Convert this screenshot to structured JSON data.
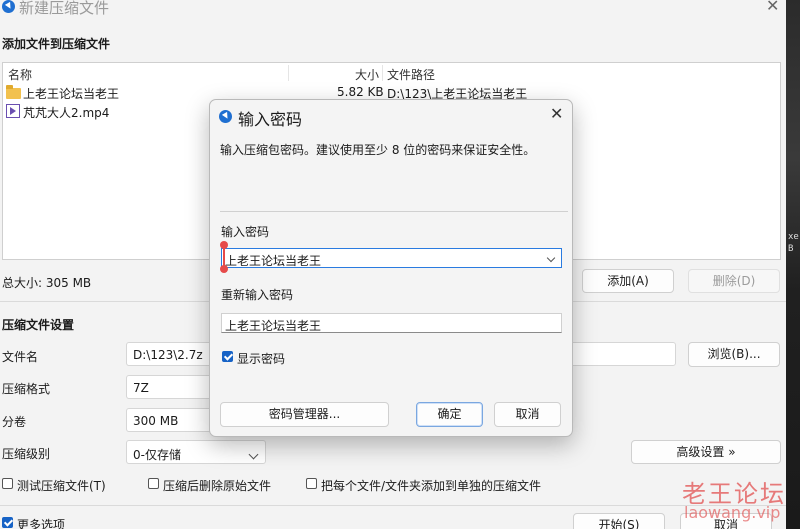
{
  "window": {
    "title": "新建压缩文件",
    "close_glyph": "✕",
    "icon": "7zip-app-icon"
  },
  "add_files": {
    "section_title": "添加文件到压缩文件",
    "columns": {
      "name": "名称",
      "size": "大小",
      "path": "文件路径"
    },
    "rows": [
      {
        "icon": "folder-icon",
        "name": "上老王论坛当老王",
        "size": "5.82 KB",
        "path": "D:\\123\\上老王论坛当老王"
      },
      {
        "icon": "video-file-icon",
        "name": "芃芃大人2.mp4",
        "size": "",
        "path": ""
      }
    ],
    "total_size": "总大小: 305 MB",
    "add_button": "添加(A)",
    "remove_button": "删除(D)"
  },
  "settings": {
    "section_title": "压缩文件设置",
    "filename_label": "文件名",
    "filename_value": "D:\\123\\2.7z",
    "browse_button": "浏览(B)...",
    "format_label": "压缩格式",
    "format_value": "7Z",
    "volume_label": "分卷",
    "volume_value": "300 MB",
    "level_label": "压缩级别",
    "level_value": "0-仅存储",
    "advanced_button": "高级设置 »",
    "options": [
      {
        "label": "测试压缩文件(T)",
        "checked": false
      },
      {
        "label": "压缩后删除原始文件",
        "checked": false
      },
      {
        "label": "把每个文件/文件夹添加到单独的压缩文件",
        "checked": false
      }
    ],
    "more_options_label": "更多选项",
    "more_options_checked": true,
    "start_button": "开始(S)",
    "cancel_button": "取消"
  },
  "password_dialog": {
    "title": "输入密码",
    "close_glyph": "✕",
    "description": "输入压缩包密码。建议使用至少 8 位的密码来保证安全性。",
    "password_label": "输入密码",
    "password_value": "上老王论坛当老王",
    "confirm_label": "重新输入密码",
    "confirm_value": "上老王论坛当老王",
    "show_password_label": "显示密码",
    "show_password_checked": true,
    "manager_button": "密码管理器...",
    "ok_button": "确定",
    "cancel_button": "取消"
  },
  "background_strip": {
    "text_1": "xe",
    "text_2": "B"
  },
  "watermark": {
    "line1": "老王论坛",
    "line2": "laowang.vip"
  },
  "colors": {
    "accent": "#1763c6",
    "focus": "#2a7be0",
    "watermark": "#e15050",
    "folder": "#f2c14e"
  }
}
